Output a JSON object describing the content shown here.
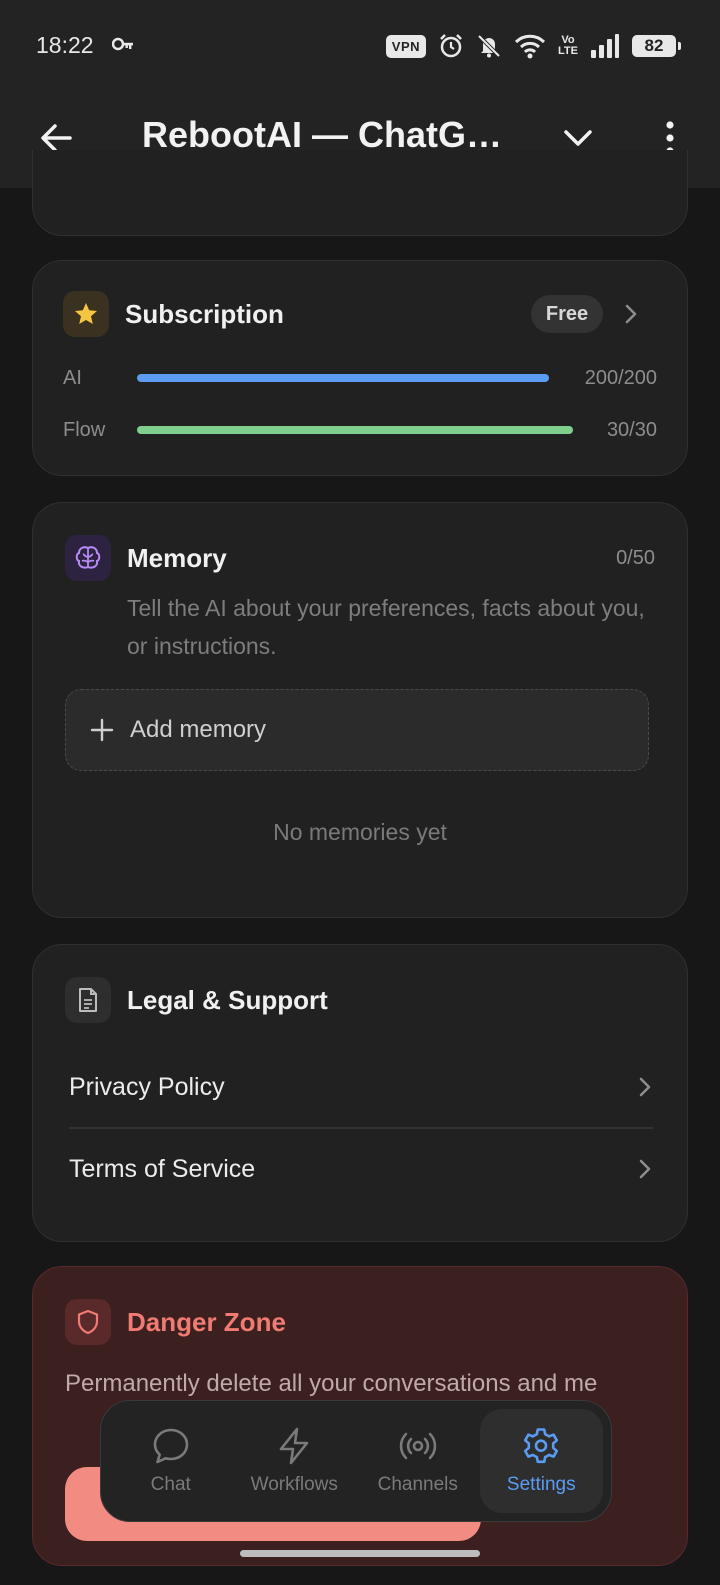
{
  "status_bar": {
    "time": "18:22",
    "vpn_label": "VPN",
    "volte_top": "Vo",
    "volte_bottom": "LTE",
    "battery": "82"
  },
  "app_bar": {
    "title": "RebootAI — ChatGPT",
    "icons": [
      "arrow-left-icon",
      "chevron-down-icon",
      "more-vertical-icon"
    ]
  },
  "subscription": {
    "title": "Subscription",
    "plan": "Free",
    "quotas": [
      {
        "label": "AI",
        "value": "200/200",
        "fill": 1.0,
        "color": "#5b9cf2"
      },
      {
        "label": "Flow",
        "value": "30/30",
        "fill": 1.0,
        "color": "#7fd08f"
      }
    ]
  },
  "memory": {
    "title": "Memory",
    "count": "0/50",
    "description": "Tell the AI about your preferences, facts about you, or instructions.",
    "add_label": "Add memory",
    "empty_text": "No memories yet"
  },
  "legal": {
    "title": "Legal & Support",
    "items": [
      {
        "label": "Privacy Policy"
      },
      {
        "label": "Terms of Service"
      }
    ]
  },
  "danger": {
    "title": "Danger Zone",
    "description": "Permanently delete all your conversations and me"
  },
  "bottom_nav": {
    "items": [
      {
        "label": "Chat",
        "icon": "chat-bubble-icon"
      },
      {
        "label": "Workflows",
        "icon": "lightning-icon"
      },
      {
        "label": "Channels",
        "icon": "broadcast-icon"
      },
      {
        "label": "Settings",
        "icon": "gear-icon",
        "active": true
      }
    ]
  },
  "colors": {
    "accent": "#5b9cf2",
    "danger": "#f07b72",
    "flow_green": "#7fd08f"
  }
}
